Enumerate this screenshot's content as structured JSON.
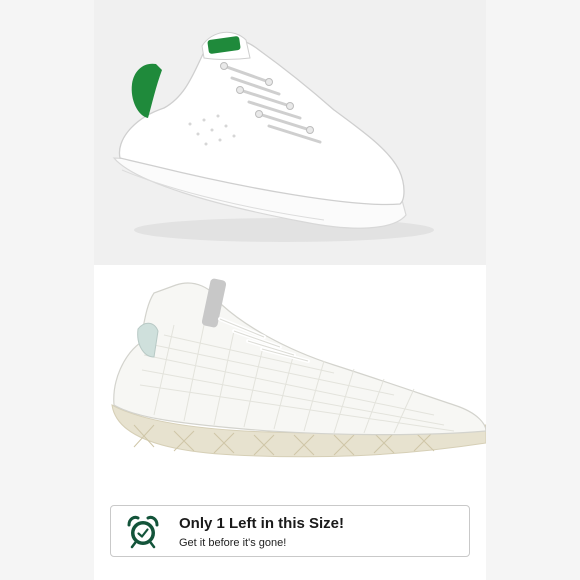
{
  "photos": [
    {
      "subject": "white leather sneaker with green heel tab",
      "colors": {
        "upper": "#ffffff",
        "heel_tab": "#1f8a3b"
      }
    },
    {
      "subject": "white knit mesh tennis sneaker with cream sole",
      "colors": {
        "upper": "#f3f3ef",
        "sole": "#e7e2cf",
        "heel_tab": "#cfe0dc"
      }
    }
  ],
  "banner": {
    "title": "Only 1 Left in this Size!",
    "subtitle": "Get it before it's gone!",
    "icon": "alarm-clock-icon",
    "accent_color": "#13543a"
  }
}
